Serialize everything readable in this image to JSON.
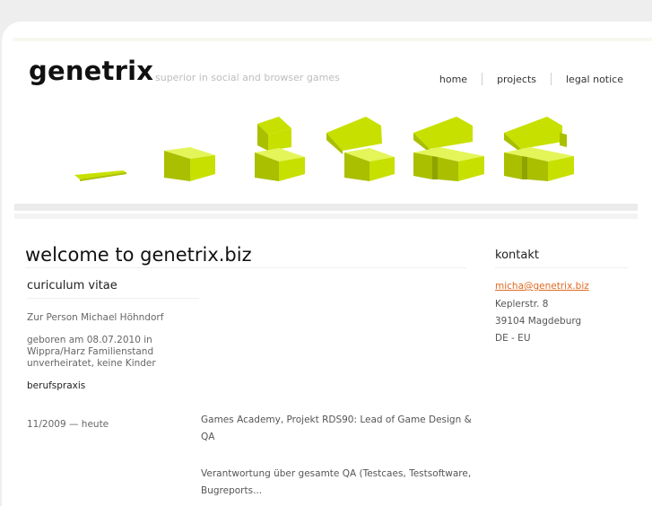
{
  "header": {
    "logo": "genetrix",
    "tagline": "superior in social and browser games",
    "nav": [
      "home",
      "projects",
      "legal notice"
    ]
  },
  "banner": {
    "accent_color": "#c8e000",
    "shade_color": "#a9bf00",
    "light_color": "#e4f55a"
  },
  "main": {
    "title": "welcome to genetrix.biz",
    "section_title": "curiculum vitae",
    "person_line": "Zur Person Michael Höhndorf",
    "bio_lines": [
      "geboren am 08.07.2010 in",
      "Wippra/Harz Familienstand",
      "unverheiratet, keine Kinder"
    ],
    "experience_label": "berufspraxis",
    "entries": [
      {
        "date": "11/2009 — heute",
        "lines": [
          "Games Academy, Projekt RDS90: Lead of Game Design &",
          "QA"
        ],
        "extra": "Verantwortung über gesamte QA (Testcaes, Testsoftware,",
        "cut": "Bugreports..."
      }
    ]
  },
  "sidebar": {
    "title": "kontakt",
    "email": "micha@genetrix.biz",
    "address": [
      "Keplerstr. 8",
      "39104 Magdeburg",
      "DE - EU"
    ]
  }
}
